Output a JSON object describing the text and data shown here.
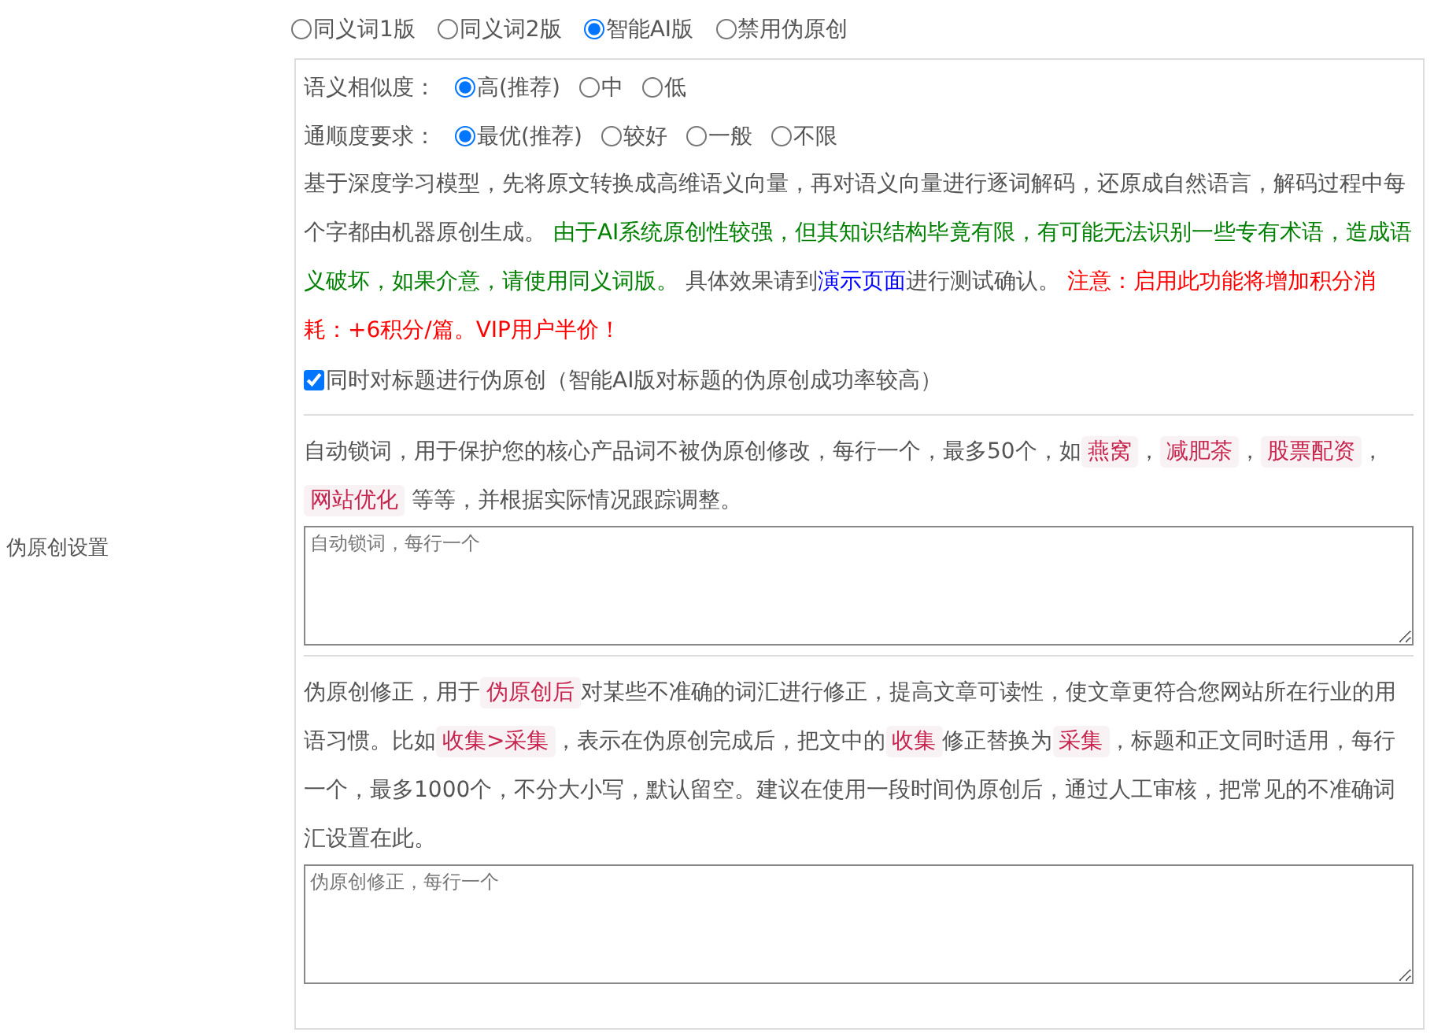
{
  "mode_options": [
    {
      "label": "同义词1版",
      "selected": false
    },
    {
      "label": "同义词2版",
      "selected": false
    },
    {
      "label": "智能AI版",
      "selected": true
    },
    {
      "label": "禁用伪原创",
      "selected": false
    }
  ],
  "settings_label": "伪原创设置",
  "ai_settings": {
    "rows": [
      {
        "label": "语义相似度：",
        "options": [
          {
            "label": "高(推荐)",
            "selected": true
          },
          {
            "label": "中",
            "selected": false
          },
          {
            "label": "低",
            "selected": false
          }
        ]
      },
      {
        "label": "通顺度要求：",
        "options": [
          {
            "label": "最优(推荐)",
            "selected": true
          },
          {
            "label": "较好",
            "selected": false
          },
          {
            "label": "一般",
            "selected": false
          },
          {
            "label": "不限",
            "selected": false
          }
        ]
      }
    ],
    "description": [
      {
        "kind": "plain",
        "text": "基于深度学习模型，先将原文转换成高维语义向量，再对语义向量进行逐词解码，还原成自然语言，解码过程中每个字都由机器原创生成。 "
      },
      {
        "kind": "green",
        "text": "由于AI系统原创性较强，但其知识结构毕竟有限，有可能无法识别一些专有术语，造成语义破坏，如果介意，请使用同义词版。"
      },
      {
        "kind": "plain",
        "text": " 具体效果请到"
      },
      {
        "kind": "link",
        "text": "演示页面"
      },
      {
        "kind": "plain",
        "text": "进行测试确认。 "
      },
      {
        "kind": "red",
        "text": "注意：启用此功能将增加积分消耗：+6积分/篇。VIP用户半价！"
      }
    ],
    "title_option": {
      "label": "同时对标题进行伪原创（智能AI版对标题的伪原创成功率较高）",
      "checked": true
    }
  },
  "lock_words": {
    "description": [
      {
        "kind": "plain",
        "text": "自动锁词，用于保护您的核心产品词不被伪原创修改，每行一个，最多50个，如"
      },
      {
        "kind": "code",
        "text": "燕窝"
      },
      {
        "kind": "plain",
        "text": "，"
      },
      {
        "kind": "code",
        "text": "减肥茶"
      },
      {
        "kind": "plain",
        "text": "，"
      },
      {
        "kind": "code",
        "text": "股票配资"
      },
      {
        "kind": "plain",
        "text": "，"
      },
      {
        "kind": "code",
        "text": "网站优化"
      },
      {
        "kind": "plain",
        "text": " 等等，并根据实际情况跟踪调整。"
      }
    ],
    "placeholder": "自动锁词，每行一个"
  },
  "corrections": {
    "description": [
      {
        "kind": "plain",
        "text": "伪原创修正，用于"
      },
      {
        "kind": "code",
        "text": "伪原创后"
      },
      {
        "kind": "plain",
        "text": "对某些不准确的词汇进行修正，提高文章可读性，使文章更符合您网站所在行业的用语习惯。比如"
      },
      {
        "kind": "code",
        "text": "收集>采集"
      },
      {
        "kind": "plain",
        "text": "，表示在伪原创完成后，把文中的"
      },
      {
        "kind": "code",
        "text": "收集"
      },
      {
        "kind": "plain",
        "text": "修正替换为"
      },
      {
        "kind": "code",
        "text": "采集"
      },
      {
        "kind": "plain",
        "text": "，标题和正文同时适用，每行一个，最多1000个，不分大小写，默认留空。建议在使用一段时间伪原创后，通过人工审核，把常见的不准确词汇设置在此。"
      }
    ],
    "placeholder": "伪原创修正，每行一个"
  }
}
